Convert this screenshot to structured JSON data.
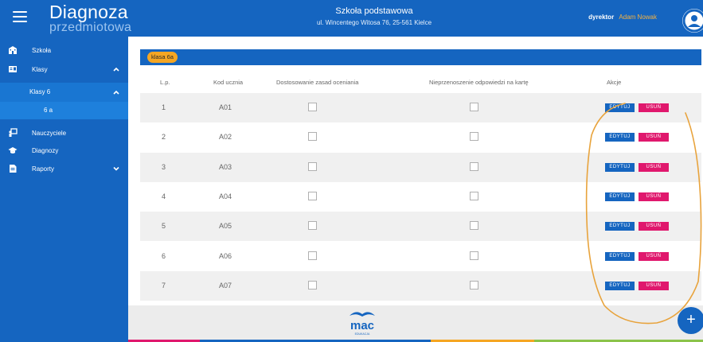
{
  "header": {
    "logo_line1": "Diagnoza",
    "logo_line2": "przedmiotowa",
    "school_name": "Szkoła podstawowa",
    "school_address": "ul. Wincentego Witosa 76, 25-561 Kielce",
    "user_role": "dyrektor",
    "user_name": "Adam Nowak"
  },
  "sidebar": {
    "items": [
      {
        "label": "Szkoła",
        "icon": "school-icon"
      },
      {
        "label": "Klasy",
        "icon": "class-icon"
      },
      {
        "label": "Nauczyciele",
        "icon": "teacher-icon"
      },
      {
        "label": "Diagnozy",
        "icon": "graduation-cap-icon"
      },
      {
        "label": "Raporty",
        "icon": "report-icon"
      }
    ],
    "sub_class_group": "Klasy 6",
    "sub_class": "6 a"
  },
  "main": {
    "class_tag": "klasa 6a",
    "headers": {
      "lp": "L.p.",
      "code": "Kod ucznia",
      "adjust": "Dostosowanie zasad oceniania",
      "notransfer": "Nieprzenoszenie odpowiedzi na kartę",
      "actions": "Akcje"
    },
    "edit_label": "EDYTUJ",
    "delete_label": "USUŃ",
    "rows": [
      {
        "lp": "1",
        "code": "A01"
      },
      {
        "lp": "2",
        "code": "A02"
      },
      {
        "lp": "3",
        "code": "A03"
      },
      {
        "lp": "4",
        "code": "A04"
      },
      {
        "lp": "5",
        "code": "A05"
      },
      {
        "lp": "6",
        "code": "A06"
      },
      {
        "lp": "7",
        "code": "A07"
      }
    ]
  },
  "footer": {
    "logo_text": "mac",
    "logo_sub": "EDUKACJA"
  },
  "fab_label": "+",
  "colors": {
    "primary": "#1565c0",
    "accent": "#f5a623",
    "danger": "#e0186d",
    "annotation": "#e8a33c"
  }
}
